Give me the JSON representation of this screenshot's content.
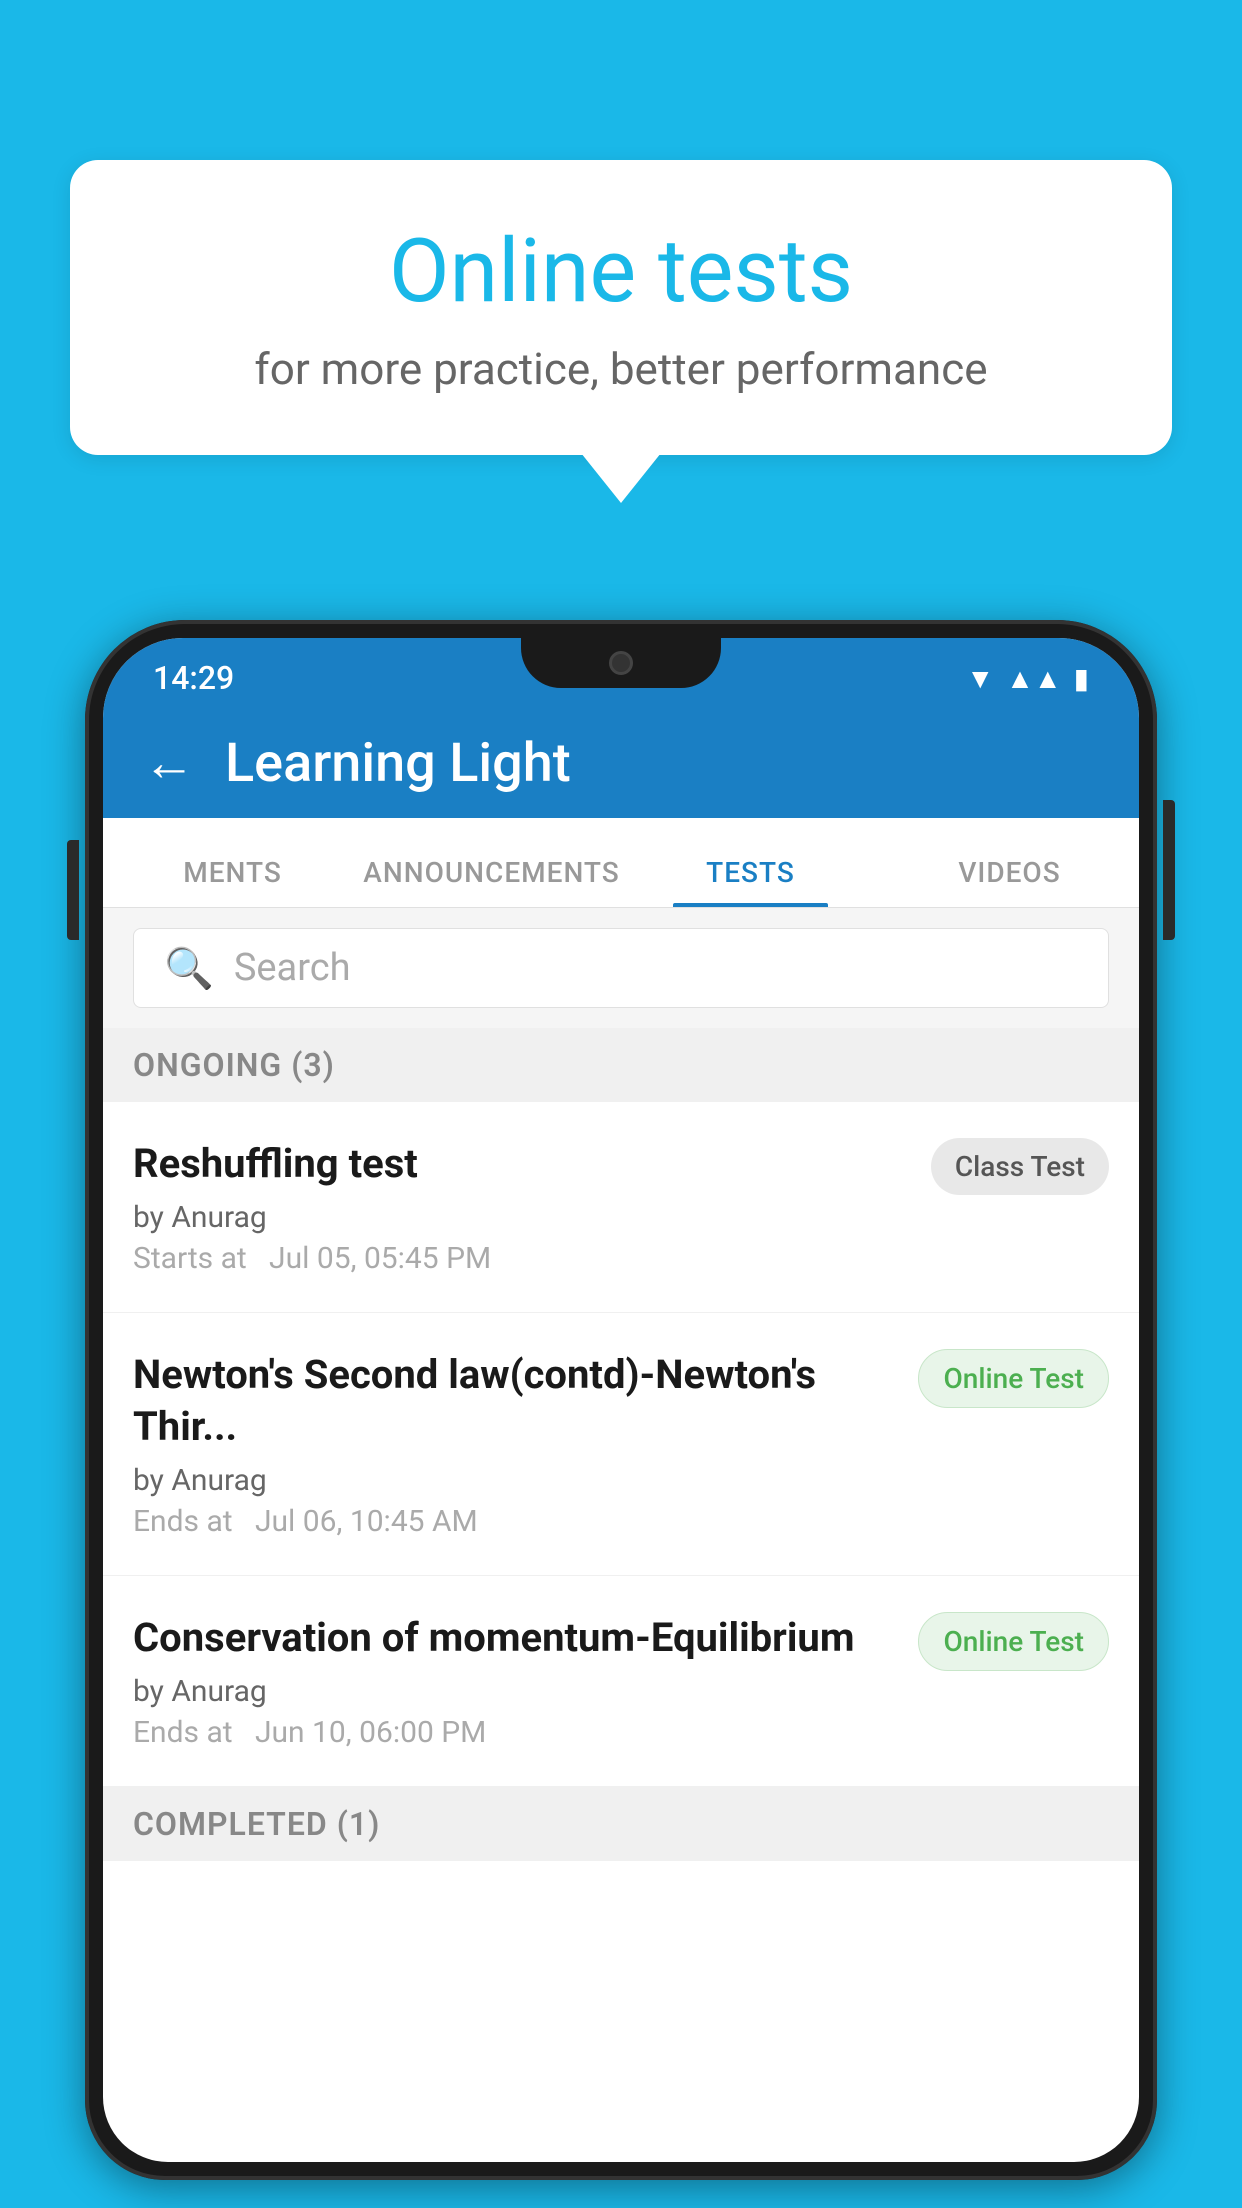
{
  "background_color": "#1ab8e8",
  "speech_bubble": {
    "title": "Online tests",
    "subtitle": "for more practice, better performance"
  },
  "phone": {
    "status_bar": {
      "time": "14:29",
      "wifi": "▼",
      "signal": "▲",
      "battery": "▮"
    },
    "app_bar": {
      "back_label": "←",
      "title": "Learning Light"
    },
    "tabs": [
      {
        "label": "MENTS",
        "active": false
      },
      {
        "label": "ANNOUNCEMENTS",
        "active": false
      },
      {
        "label": "TESTS",
        "active": true
      },
      {
        "label": "VIDEOS",
        "active": false
      }
    ],
    "search": {
      "placeholder": "Search"
    },
    "ongoing_section": {
      "title": "ONGOING (3)"
    },
    "tests": [
      {
        "name": "Reshuffling test",
        "author": "by Anurag",
        "time_label": "Starts at",
        "time": "Jul 05, 05:45 PM",
        "badge": "Class Test",
        "badge_type": "class"
      },
      {
        "name": "Newton's Second law(contd)-Newton's Thir...",
        "author": "by Anurag",
        "time_label": "Ends at",
        "time": "Jul 06, 10:45 AM",
        "badge": "Online Test",
        "badge_type": "online"
      },
      {
        "name": "Conservation of momentum-Equilibrium",
        "author": "by Anurag",
        "time_label": "Ends at",
        "time": "Jun 10, 06:00 PM",
        "badge": "Online Test",
        "badge_type": "online"
      }
    ],
    "completed_section": {
      "title": "COMPLETED (1)"
    }
  }
}
